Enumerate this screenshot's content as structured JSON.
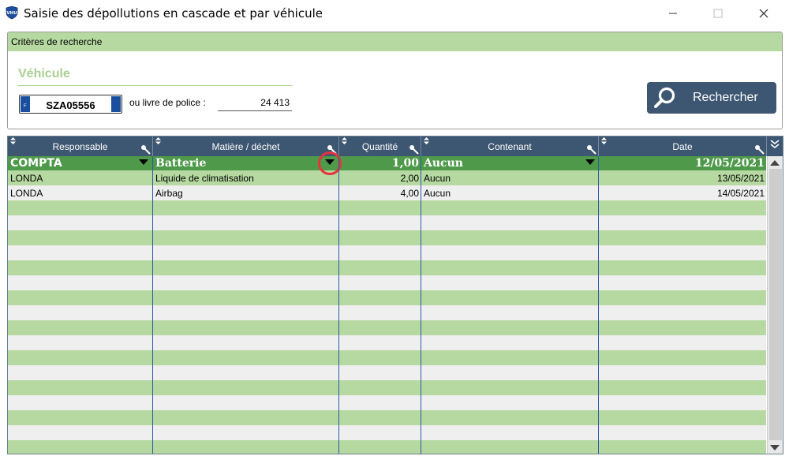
{
  "window": {
    "title": "Saisie des dépollutions en cascade et par véhicule",
    "app_icon": "vhu-shield-icon",
    "controls": {
      "minimize": "—",
      "maximize": "☐",
      "close": "✕"
    }
  },
  "search": {
    "panel_title": "Critères de recherche",
    "section_title": "Véhicule",
    "plate": {
      "country": "F",
      "number": "SZA05556"
    },
    "police_label": "ou livre de police :",
    "police_value": "24 413",
    "button_label": "Rechercher"
  },
  "grid": {
    "columns": [
      {
        "key": "responsable",
        "label": "Responsable"
      },
      {
        "key": "matiere",
        "label": "Matière / déchet"
      },
      {
        "key": "quantite",
        "label": "Quantité"
      },
      {
        "key": "contenant",
        "label": "Contenant"
      },
      {
        "key": "date",
        "label": "Date"
      }
    ],
    "current_row": {
      "responsable": "COMPTA",
      "matiere": "Batterie",
      "quantite": "1,00",
      "contenant": "Aucun",
      "date": "12/05/2021"
    },
    "rows": [
      {
        "responsable": "LONDA",
        "matiere": "Liquide de climatisation",
        "quantite": "2,00",
        "contenant": "Aucun",
        "date": "13/05/2021"
      },
      {
        "responsable": "LONDA",
        "matiere": "Airbag",
        "quantite": "4,00",
        "contenant": "Aucun",
        "date": "14/05/2021"
      }
    ],
    "empty_rows": 17
  },
  "colors": {
    "accent_green": "#b5d9a0",
    "current_row_green": "#4f9a4a",
    "header_navy": "#3d5671",
    "highlight_red": "#e8323c"
  }
}
